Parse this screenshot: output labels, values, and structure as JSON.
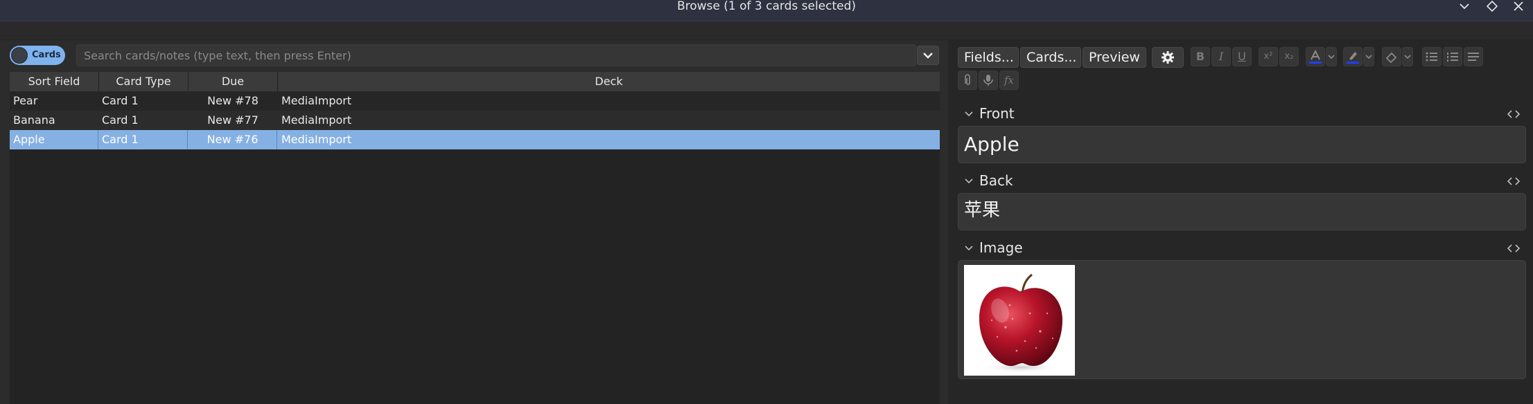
{
  "window": {
    "title": "Browse (1 of 3 cards selected)"
  },
  "toolbar": {
    "mode_label": "Cards"
  },
  "search": {
    "placeholder": "Search cards/notes (type text, then press Enter)",
    "value": ""
  },
  "table": {
    "columns": [
      "Sort Field",
      "Card Type",
      "Due",
      "Deck"
    ],
    "rows": [
      {
        "sort_field": "Pear",
        "card_type": "Card 1",
        "due": "New #78",
        "deck": "MediaImport",
        "selected": false
      },
      {
        "sort_field": "Banana",
        "card_type": "Card 1",
        "due": "New #77",
        "deck": "MediaImport",
        "selected": false
      },
      {
        "sort_field": "Apple",
        "card_type": "Card 1",
        "due": "New #76",
        "deck": "MediaImport",
        "selected": true
      }
    ]
  },
  "editor": {
    "buttons": {
      "fields": "Fields...",
      "cards": "Cards...",
      "preview": "Preview"
    },
    "format_icons": {
      "bold": "B",
      "italic": "I",
      "underline": "U",
      "superscript": "x²",
      "subscript": "x₂",
      "math": "fx"
    },
    "fields": [
      {
        "name": "Front",
        "value": "Apple"
      },
      {
        "name": "Back",
        "value": "苹果"
      },
      {
        "name": "Image",
        "value": ""
      }
    ],
    "colors": {
      "text_color_bar": "#1f3fff",
      "highlight_bar": "#1f3fff",
      "selection": "#85b0e4",
      "accent": "#7fb3ee"
    }
  }
}
